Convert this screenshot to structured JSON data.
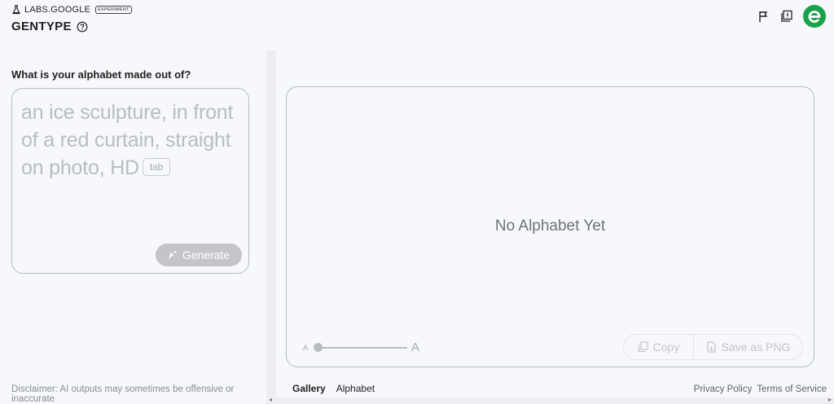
{
  "header": {
    "labs_label": "LABS.GOOGLE",
    "experiment_badge": "EXPERIMENT",
    "app_title": "GENTYPE"
  },
  "prompt": {
    "question": "What is your alphabet made out of?",
    "placeholder": "an ice sculpture, in front of a red curtain, straight on photo, HD",
    "tab_hint": "tab",
    "generate_label": "Generate"
  },
  "disclaimer": "Disclaimer: AI outputs may sometimes be offensive or inaccurate",
  "canvas": {
    "empty_message": "No Alphabet Yet",
    "size_small_label": "A",
    "size_large_label": "A",
    "size_slider_value": 0,
    "copy_label": "Copy",
    "save_label": "Save as PNG"
  },
  "tabs": [
    {
      "label": "Gallery",
      "active": true
    },
    {
      "label": "Alphabet",
      "active": false
    }
  ],
  "footer": {
    "privacy": "Privacy Policy",
    "terms": "Terms of Service"
  },
  "icons": {
    "labs": "flask-icon",
    "help": "help-circle-icon",
    "feedback": "flag-icon",
    "info": "report-icon",
    "avatar": "user-avatar",
    "generate": "sparkle-send-icon",
    "copy": "copy-icon",
    "save": "save-file-icon"
  },
  "colors": {
    "background": "#f6f8fb",
    "avatar_green": "#1aa34a",
    "generate_disabled": "#c3c5c8"
  }
}
